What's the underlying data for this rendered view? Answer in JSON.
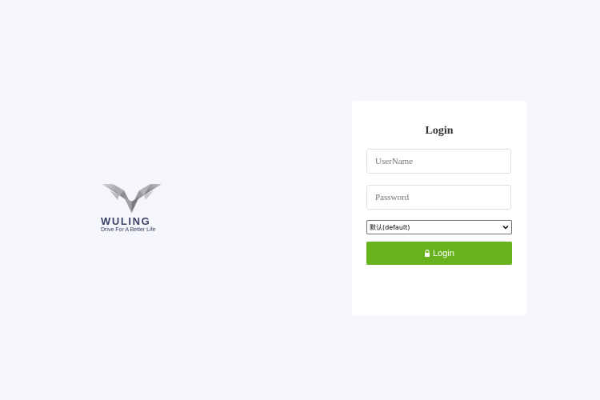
{
  "brand": {
    "wordmark": "WULING",
    "tagline": "Drive For A Better Life",
    "text_color": "#3b4366",
    "logo_icon": "wuling-diamond-logo"
  },
  "login": {
    "title": "Login",
    "username_placeholder": "UserName",
    "password_placeholder": "Password",
    "language_selected": "默认(default)",
    "button_label": "Login",
    "button_icon": "lock-icon",
    "button_color": "#67b21d"
  },
  "colors": {
    "background": "#f4f6fb",
    "card": "#ffffff"
  }
}
